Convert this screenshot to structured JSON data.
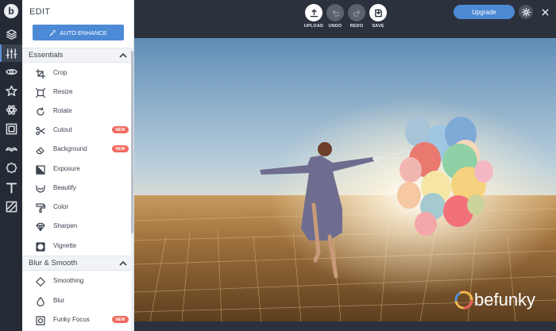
{
  "panel": {
    "title": "EDIT",
    "auto_enhance_label": "AUTO ENHANCE"
  },
  "sections": [
    {
      "title": "Essentials",
      "expanded": true
    },
    {
      "title": "Blur & Smooth",
      "expanded": true
    }
  ],
  "essentials_tools": [
    {
      "label": "Crop",
      "icon": "crop-icon"
    },
    {
      "label": "Resize",
      "icon": "resize-icon"
    },
    {
      "label": "Rotate",
      "icon": "rotate-icon"
    },
    {
      "label": "Cutout",
      "icon": "scissors-icon",
      "badge": "NEW"
    },
    {
      "label": "Background",
      "icon": "eraser-icon",
      "badge": "NEW"
    },
    {
      "label": "Exposure",
      "icon": "exposure-icon"
    },
    {
      "label": "Beautify",
      "icon": "mustache-icon"
    },
    {
      "label": "Color",
      "icon": "paint-roller-icon"
    },
    {
      "label": "Sharpen",
      "icon": "diamond-icon"
    },
    {
      "label": "Vignette",
      "icon": "vignette-icon"
    }
  ],
  "blur_tools": [
    {
      "label": "Smoothing",
      "icon": "smoothing-icon"
    },
    {
      "label": "Blur",
      "icon": "drop-icon"
    },
    {
      "label": "Funky Focus",
      "icon": "focus-icon",
      "badge": "NEW"
    }
  ],
  "toolbar": {
    "upload_label": "UPLOAD",
    "undo_label": "UNDO",
    "redo_label": "REDO",
    "save_label": "SAVE",
    "upgrade_label": "Upgrade"
  },
  "rail_icons": [
    "befunky-logo",
    "layers-icon",
    "sliders-icon",
    "eye-icon",
    "star-icon",
    "atom-icon",
    "frame-icon",
    "mustache-icon",
    "badge-icon",
    "text-icon",
    "texture-icon"
  ],
  "watermark": "befunky",
  "colors": {
    "accent": "#4c8ad6",
    "badge": "#f06a5f",
    "dark_ui": "#2b323e"
  }
}
